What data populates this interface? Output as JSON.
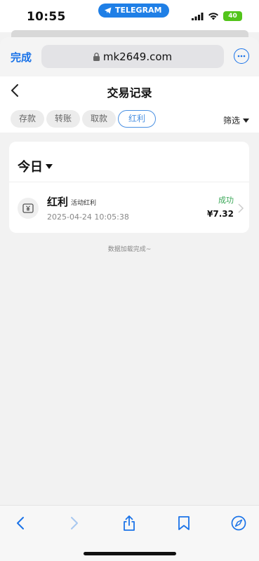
{
  "status_bar": {
    "time": "10:55",
    "telegram_label": "TELEGRAM",
    "battery": "40"
  },
  "browser": {
    "done_label": "完成",
    "url": "mk2649.com"
  },
  "page": {
    "title": "交易记录"
  },
  "tabs": [
    {
      "label": "存款",
      "active": false
    },
    {
      "label": "转账",
      "active": false
    },
    {
      "label": "取款",
      "active": false
    },
    {
      "label": "红利",
      "active": true
    }
  ],
  "filter_label": "筛选",
  "section": {
    "title": "今日"
  },
  "transactions": [
    {
      "title": "红利",
      "subtitle": "活动红利",
      "time": "2025-04-24 10:05:38",
      "status": "成功",
      "amount": "¥7.32"
    }
  ],
  "footer_text": "数据加载完成~",
  "colors": {
    "accent": "#1a73e8",
    "success": "#3aa757",
    "tab_active": "#4a90e2",
    "telegram": "#1f7fe6",
    "battery": "#52c41a"
  }
}
